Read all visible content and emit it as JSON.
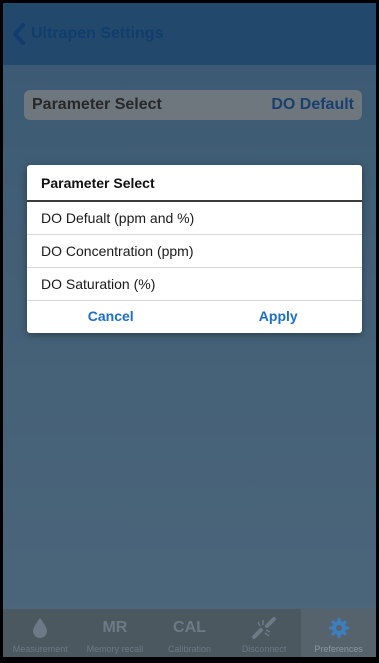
{
  "navbar": {
    "back_label": "Ultrapen Settings"
  },
  "settings": {
    "label": "Parameter Select",
    "value": "DO Default"
  },
  "dialog": {
    "title": "Parameter Select",
    "options": [
      "DO Defualt (ppm and %)",
      "DO Concentration (ppm)",
      "DO Saturation (%)"
    ],
    "cancel": "Cancel",
    "apply": "Apply"
  },
  "tabbar": {
    "tabs": [
      {
        "icon": "drop-icon",
        "label": "Measurement"
      },
      {
        "icon": "MR",
        "label": "Memory recall"
      },
      {
        "icon": "CAL",
        "label": "Calibration"
      },
      {
        "icon": "disconnect-icon",
        "label": "Disconnect"
      },
      {
        "icon": "gear-icon",
        "label": "Preferences"
      }
    ],
    "active": "Preferences"
  },
  "colors": {
    "accent": "#1b6fc6",
    "navbar": "#3f86c4",
    "tabbar": "#4c5860"
  }
}
